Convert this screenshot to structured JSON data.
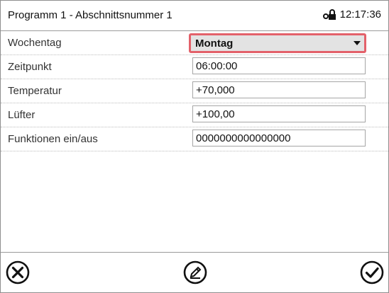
{
  "header": {
    "title": "Programm 1 - Abschnittsnummer 1",
    "lock_icon": "door-lock-icon",
    "time": "12:17:36"
  },
  "rows": [
    {
      "label": "Wochentag",
      "value": "Montag",
      "type": "dropdown"
    },
    {
      "label": "Zeitpunkt",
      "value": "06:00:00",
      "type": "input"
    },
    {
      "label": "Temperatur",
      "value": "+70,000",
      "type": "input"
    },
    {
      "label": "Lüfter",
      "value": "+100,00",
      "type": "input"
    },
    {
      "label": "Funktionen ein/aus",
      "value": "0000000000000000",
      "type": "input"
    }
  ],
  "footer": {
    "cancel_icon": "close-circle-icon",
    "edit_icon": "edit-pencil-icon",
    "confirm_icon": "checkmark-circle-icon"
  },
  "colors": {
    "selection_border": "#e3616a",
    "dropdown_bg": "#e3e3e3"
  }
}
